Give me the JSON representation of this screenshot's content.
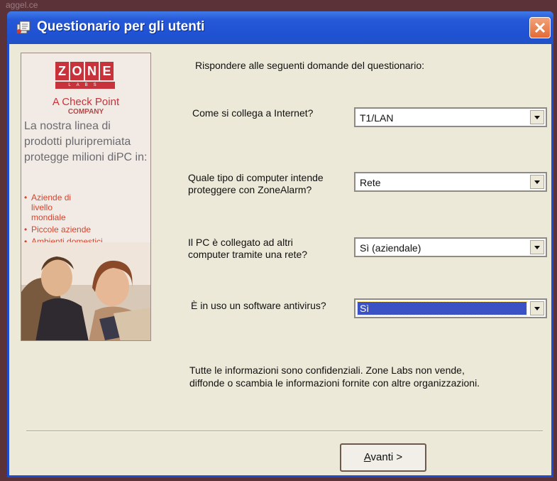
{
  "background_text": "aggel.ce",
  "window": {
    "title": "Questionario per gli utenti"
  },
  "banner": {
    "logo_letters": [
      "Z",
      "O",
      "N",
      "E"
    ],
    "logo_sub": "LABS",
    "cp_line": "A Check Point",
    "cp_company": "COMPANY",
    "body": "La nostra linea di prodotti pluripremiata protegge milioni diPC in:",
    "bullets": [
      "Aziende di livello mondiale",
      "Piccole aziende",
      "Ambienti domestici"
    ]
  },
  "form": {
    "intro": "Rispondere alle seguenti domande del questionario:",
    "q1": {
      "label": "Come si collega a Internet?",
      "value": "T1/LAN"
    },
    "q2": {
      "label_line1": "Quale tipo di computer intende",
      "label_line2": "proteggere con ZoneAlarm?",
      "value": "Rete"
    },
    "q3": {
      "label_line1": "Il PC è collegato ad altri",
      "label_line2": "computer tramite una rete?",
      "value": "Sì (aziendale)"
    },
    "q4": {
      "label": "È in uso un software antivirus?",
      "value": "Sì"
    }
  },
  "privacy": {
    "line1": "Tutte le informazioni sono confidenziali. Zone Labs non vende,",
    "line2": "diffonde o scambia le informazioni fornite con altre organizzazioni."
  },
  "buttons": {
    "next_underlined": "A",
    "next_rest": "vanti >"
  },
  "colors": {
    "titlebar": "#2659d8",
    "brand_red": "#c8323a",
    "selection": "#3a52c4"
  }
}
